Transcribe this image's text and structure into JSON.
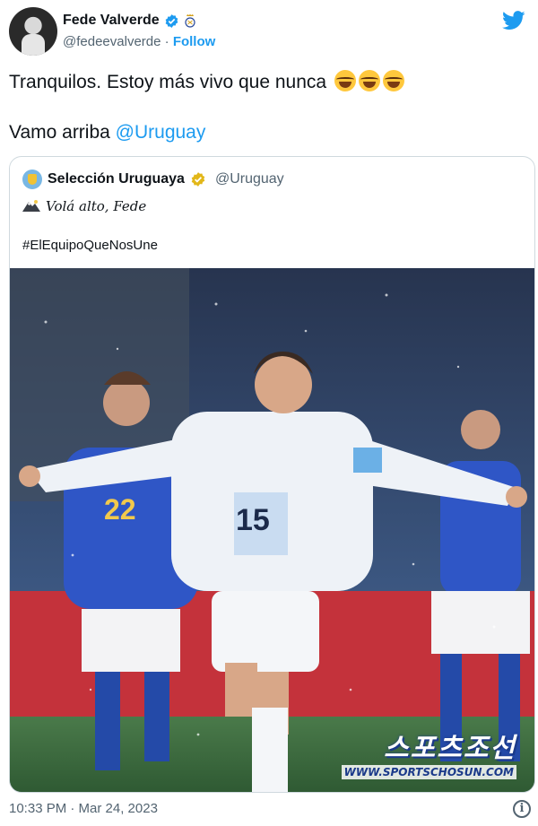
{
  "author": {
    "name": "Fede Valverde",
    "handle": "@fedeevalverde",
    "separator": "·",
    "follow_label": "Follow"
  },
  "tweet": {
    "text": "Tranquilos. Estoy más vivo que nunca",
    "line2_prefix": "Vamo arriba ",
    "line2_mention": "@Uruguay"
  },
  "quoted": {
    "name": "Selección Uruguaya",
    "handle": "@Uruguay",
    "line1": "Volá alto, Fede",
    "hashtag": "#ElEquipoQueNosUne",
    "photo": {
      "player_number": "15",
      "opponent_number": "22",
      "watermark_text": "스포츠조선",
      "watermark_url": "WWW.SPORTSCHOSUN.COM"
    }
  },
  "footer": {
    "timestamp": "10:33 PM · Mar 24, 2023",
    "info_icon": "i"
  },
  "colors": {
    "brand_blue": "#1d9bf0",
    "verified_gold": "#e2b719",
    "secondary_text": "#536471"
  },
  "icons": [
    "verified-badge-icon",
    "real-madrid-crest-icon",
    "twitter-bird-icon",
    "laughing-emoji-icon",
    "mountain-icon",
    "info-icon"
  ]
}
